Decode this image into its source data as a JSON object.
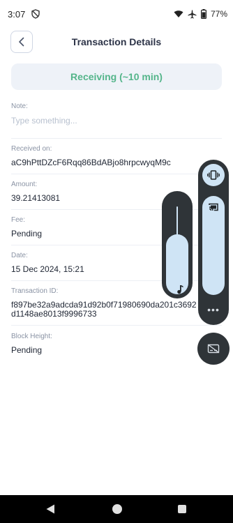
{
  "status_bar": {
    "time": "3:07",
    "battery": "77%",
    "icons": [
      "do-not-disturb-icon",
      "wifi-icon",
      "airplane-icon",
      "battery-icon"
    ]
  },
  "header": {
    "title": "Transaction Details",
    "back_icon": "chevron-left-icon"
  },
  "banner": {
    "text": "Receiving (~10 min)",
    "color": "#54b58a"
  },
  "fields": {
    "note": {
      "label": "Note:",
      "placeholder": "Type something..."
    },
    "received_on": {
      "label": "Received on:",
      "value": "aC9hPttDZcF6Rqq86BdABjo8hrpcwyqM9c"
    },
    "amount": {
      "label": "Amount:",
      "value": "39.21413081"
    },
    "fee": {
      "label": "Fee:",
      "value": "Pending"
    },
    "date": {
      "label": "Date:",
      "value": "15 Dec 2024, 15:21"
    },
    "transaction_id": {
      "label": "Transaction ID:",
      "value_line1": "f897be32a9adcda91d92b0f71980690da201c3692",
      "value_line2": "d1148ae8013f9996733"
    },
    "block_height": {
      "label": "Block Height:",
      "value": "Pending"
    }
  },
  "overlay": {
    "more_label": "•••",
    "icons": [
      "music-note-icon",
      "vibrate-icon",
      "cast-icon",
      "captions-off-icon"
    ]
  },
  "colors": {
    "accent": "#54b58a",
    "panel": "#2f3438",
    "panel_light": "#cfe4f5"
  }
}
